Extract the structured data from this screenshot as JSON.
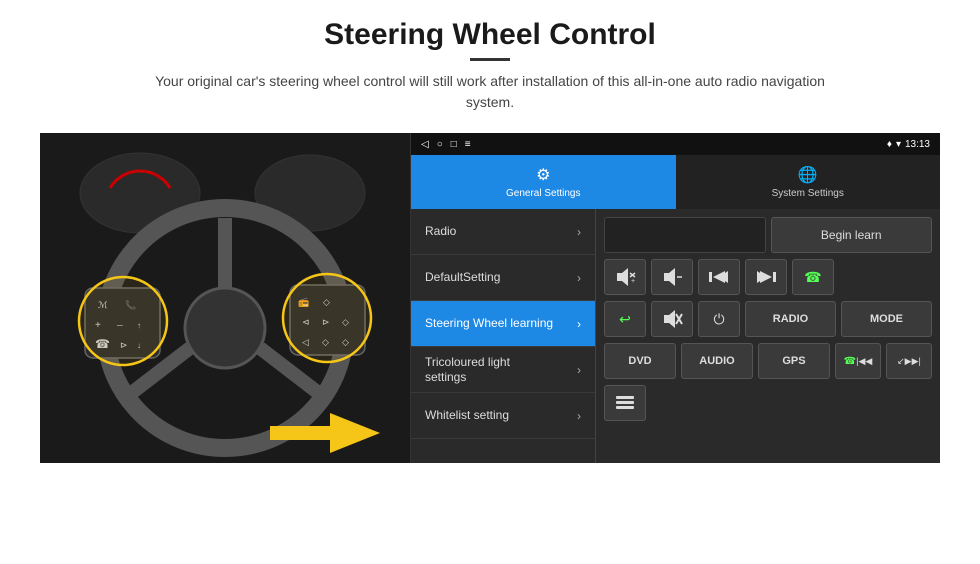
{
  "header": {
    "title": "Steering Wheel Control",
    "subtitle": "Your original car's steering wheel control will still work after installation of this all-in-one auto radio navigation system."
  },
  "status_bar": {
    "time": "13:13",
    "icons": [
      "location-icon",
      "wifi-icon",
      "signal-icon"
    ]
  },
  "nav_bar": {
    "icons": [
      "back-icon",
      "home-icon",
      "square-icon",
      "menu-icon"
    ]
  },
  "tabs": [
    {
      "label": "General Settings",
      "icon": "⚙",
      "active": true
    },
    {
      "label": "System Settings",
      "icon": "🌐",
      "active": false
    }
  ],
  "menu_items": [
    {
      "label": "Radio",
      "active": false
    },
    {
      "label": "DefaultSetting",
      "active": false
    },
    {
      "label": "Steering Wheel learning",
      "active": true
    },
    {
      "label": "Tricoloured light settings",
      "active": false
    },
    {
      "label": "Whitelist setting",
      "active": false
    }
  ],
  "controls": {
    "begin_learn": "Begin learn",
    "buttons_row1": [
      "vol+",
      "vol-",
      "|◀◀",
      "▶▶|",
      "☎"
    ],
    "buttons_row2": [
      "↩",
      "🔇",
      "⏻",
      "RADIO",
      "MODE"
    ],
    "buttons_row3": [
      "DVD",
      "AUDIO",
      "GPS",
      "☎|◀◀",
      "↙▶▶|"
    ],
    "buttons_row4": [
      "list-icon"
    ]
  }
}
